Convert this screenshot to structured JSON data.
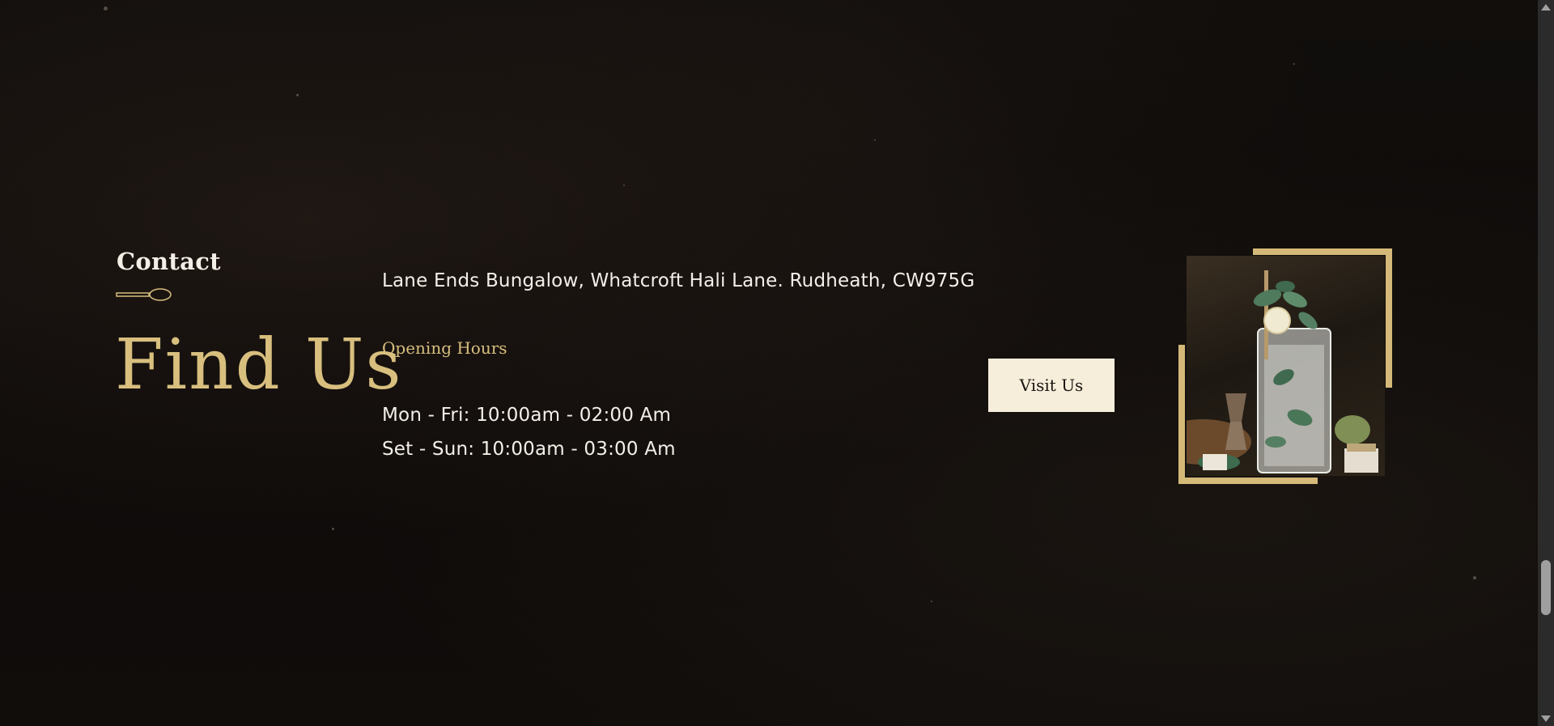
{
  "contact_section": {
    "eyebrow": "Contact",
    "heading": "Find Us",
    "address": "Lane Ends Bungalow, Whatcroft Hali Lane. Rudheath, CW975G",
    "opening_hours_title": "Opening Hours",
    "hours": [
      "Mon - Fri: 10:00am - 02:00 Am",
      "Set - Sun: 10:00am - 03:00 Am"
    ],
    "visit_button_label": "Visit Us",
    "icons": {
      "divider": "spoon-icon"
    }
  },
  "colors": {
    "background": "#0e0b0a",
    "accent_gold": "#d8bf7e",
    "frame_gold": "#d4b978",
    "text_light": "#f3efe8",
    "button_bg": "#f6eedb",
    "button_text": "#1a1410"
  }
}
